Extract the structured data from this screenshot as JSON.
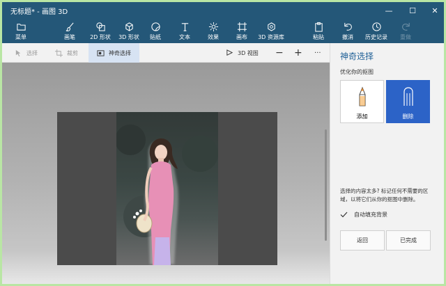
{
  "window": {
    "title": "无标题* - 画图 3D",
    "controls": [
      "—",
      "☐",
      "✕"
    ]
  },
  "ribbon": {
    "items": [
      {
        "label": "菜单",
        "icon": "folder-icon"
      },
      {
        "label": "画笔",
        "icon": "brush-icon"
      },
      {
        "label": "2D 形状",
        "icon": "2d-shapes-icon"
      },
      {
        "label": "3D 形状",
        "icon": "3d-shapes-icon"
      },
      {
        "label": "贴纸",
        "icon": "sticker-icon"
      },
      {
        "label": "文本",
        "icon": "text-icon"
      },
      {
        "label": "效果",
        "icon": "effects-icon"
      },
      {
        "label": "画布",
        "icon": "canvas-icon"
      },
      {
        "label": "3D 资源库",
        "icon": "3d-library-icon"
      },
      {
        "label": "粘贴",
        "icon": "paste-icon"
      },
      {
        "label": "撤消",
        "icon": "undo-icon"
      },
      {
        "label": "历史记录",
        "icon": "history-icon"
      },
      {
        "label": "重做",
        "icon": "redo-icon"
      }
    ]
  },
  "toolbar": {
    "select": "选择",
    "crop": "裁剪",
    "magic_select": "神奇选择",
    "view_3d": "3D 视图",
    "zoom_out": "−",
    "zoom_in": "+",
    "more": "···"
  },
  "panel": {
    "title": "神奇选择",
    "subtitle": "优化你的抠图",
    "add_label": "添加",
    "remove_label": "删除",
    "hint": "选择的内容太多? 标记任何不需要的区域，以将它们从你的抠图中删除。",
    "autofill_label": "自动填充背景",
    "autofill_checked": true,
    "back_button": "返回",
    "done_button": "已完成"
  },
  "colors": {
    "ribbon": "#245778",
    "accent": "#2c63c7",
    "panel_title": "#1e5f96"
  }
}
